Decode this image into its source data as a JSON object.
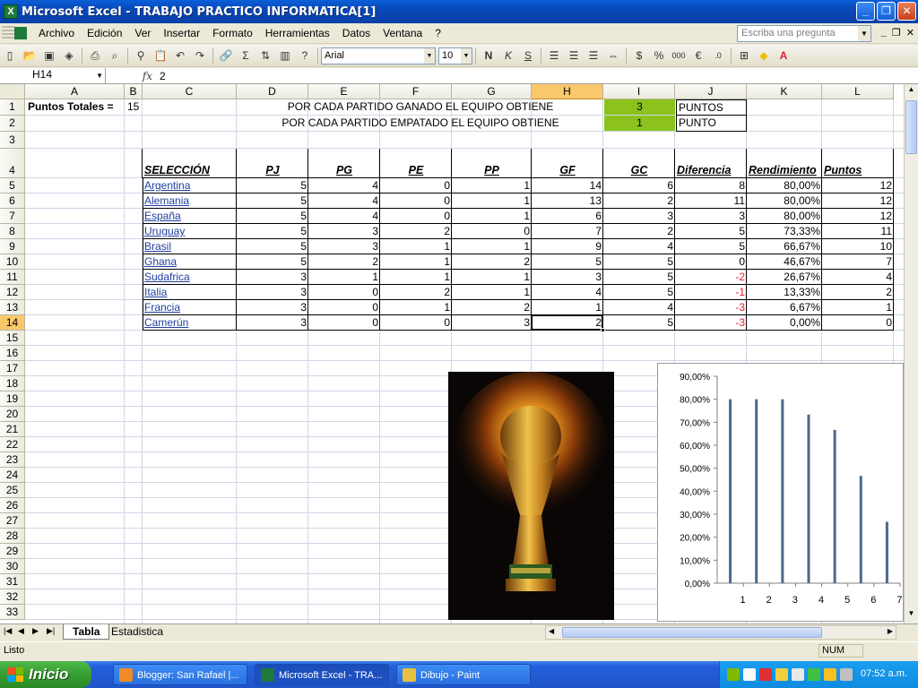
{
  "window": {
    "title": "Microsoft Excel - TRABAJO PRACTICO INFORMATICA[1]"
  },
  "menu": [
    "Archivo",
    "Edición",
    "Ver",
    "Insertar",
    "Formato",
    "Herramientas",
    "Datos",
    "Ventana",
    "?"
  ],
  "ask_placeholder": "Escriba una pregunta",
  "font": {
    "name": "Arial",
    "size": "10"
  },
  "formula_bar": {
    "cell": "H14",
    "value": "2"
  },
  "columns": [
    "A",
    "B",
    "C",
    "D",
    "E",
    "F",
    "G",
    "H",
    "I",
    "J",
    "K",
    "L"
  ],
  "rows": [
    "1",
    "2",
    "3",
    "4",
    "5",
    "6",
    "7",
    "8",
    "9",
    "10",
    "11",
    "12",
    "13",
    "14",
    "15",
    "16",
    "17",
    "18",
    "19",
    "20",
    "21",
    "22",
    "23",
    "24",
    "25",
    "26",
    "27",
    "28",
    "29",
    "30",
    "31",
    "32",
    "33"
  ],
  "header_block": {
    "puntos_totales_label": "Puntos Totales =",
    "puntos_totales_value": "15",
    "line1_text": "POR CADA PARTIDO GANADO EL EQUIPO OBTIENE",
    "line1_value": "3",
    "line1_unit": "PUNTOS",
    "line2_text": "POR CADA PARTIDO EMPATADO EL EQUIPO OBTIENE",
    "line2_value": "1",
    "line2_unit": "PUNTO"
  },
  "table": {
    "headers": [
      "SELECCIÓN",
      "PJ",
      "PG",
      "PE",
      "PP",
      "GF",
      "GC",
      "Diferencia",
      "Rendimiento",
      "Puntos"
    ],
    "rows": [
      [
        "Argentina",
        "5",
        "4",
        "0",
        "1",
        "14",
        "6",
        "8",
        "80,00%",
        "12"
      ],
      [
        "Alemania",
        "5",
        "4",
        "0",
        "1",
        "13",
        "2",
        "11",
        "80,00%",
        "12"
      ],
      [
        "España",
        "5",
        "4",
        "0",
        "1",
        "6",
        "3",
        "3",
        "80,00%",
        "12"
      ],
      [
        "Uruguay",
        "5",
        "3",
        "2",
        "0",
        "7",
        "2",
        "5",
        "73,33%",
        "11"
      ],
      [
        "Brasil",
        "5",
        "3",
        "1",
        "1",
        "9",
        "4",
        "5",
        "66,67%",
        "10"
      ],
      [
        "Ghana",
        "5",
        "2",
        "1",
        "2",
        "5",
        "5",
        "0",
        "46,67%",
        "7"
      ],
      [
        "Sudafrica",
        "3",
        "1",
        "1",
        "1",
        "3",
        "5",
        "-2",
        "26,67%",
        "4"
      ],
      [
        "Italia",
        "3",
        "0",
        "2",
        "1",
        "4",
        "5",
        "-1",
        "13,33%",
        "2"
      ],
      [
        "Francia",
        "3",
        "0",
        "1",
        "2",
        "1",
        "4",
        "-3",
        "6,67%",
        "1"
      ],
      [
        "Camerún",
        "3",
        "0",
        "0",
        "3",
        "2",
        "5",
        "-3",
        "0,00%",
        "0"
      ]
    ]
  },
  "chart_data": {
    "type": "bar",
    "categories": [
      "1",
      "2",
      "3",
      "4",
      "5",
      "6",
      "7"
    ],
    "values": [
      80,
      80,
      80,
      73.33,
      66.67,
      46.67,
      26.67
    ],
    "ylim": [
      0,
      90
    ],
    "yticks": [
      "0,00%",
      "10,00%",
      "20,00%",
      "30,00%",
      "40,00%",
      "50,00%",
      "60,00%",
      "70,00%",
      "80,00%",
      "90,00%"
    ],
    "title": "",
    "xlabel": "",
    "ylabel": "",
    "grid": false,
    "bar_color": "#4A6A8A"
  },
  "sheet_tabs": [
    "Tabla",
    "Estadistica"
  ],
  "status": {
    "text": "Listo",
    "num": "NUM"
  },
  "taskbar": {
    "start": "Inicio",
    "tasks": [
      "Blogger: San Rafael |...",
      "Microsoft Excel - TRA...",
      "Dibujo - Paint"
    ],
    "clock": "07:52 a.m."
  },
  "colors": {
    "selected_header": "#F8C86A",
    "green_cell": "#8BC21D",
    "negative": "#E0202A",
    "link": "#1F3F9F"
  }
}
